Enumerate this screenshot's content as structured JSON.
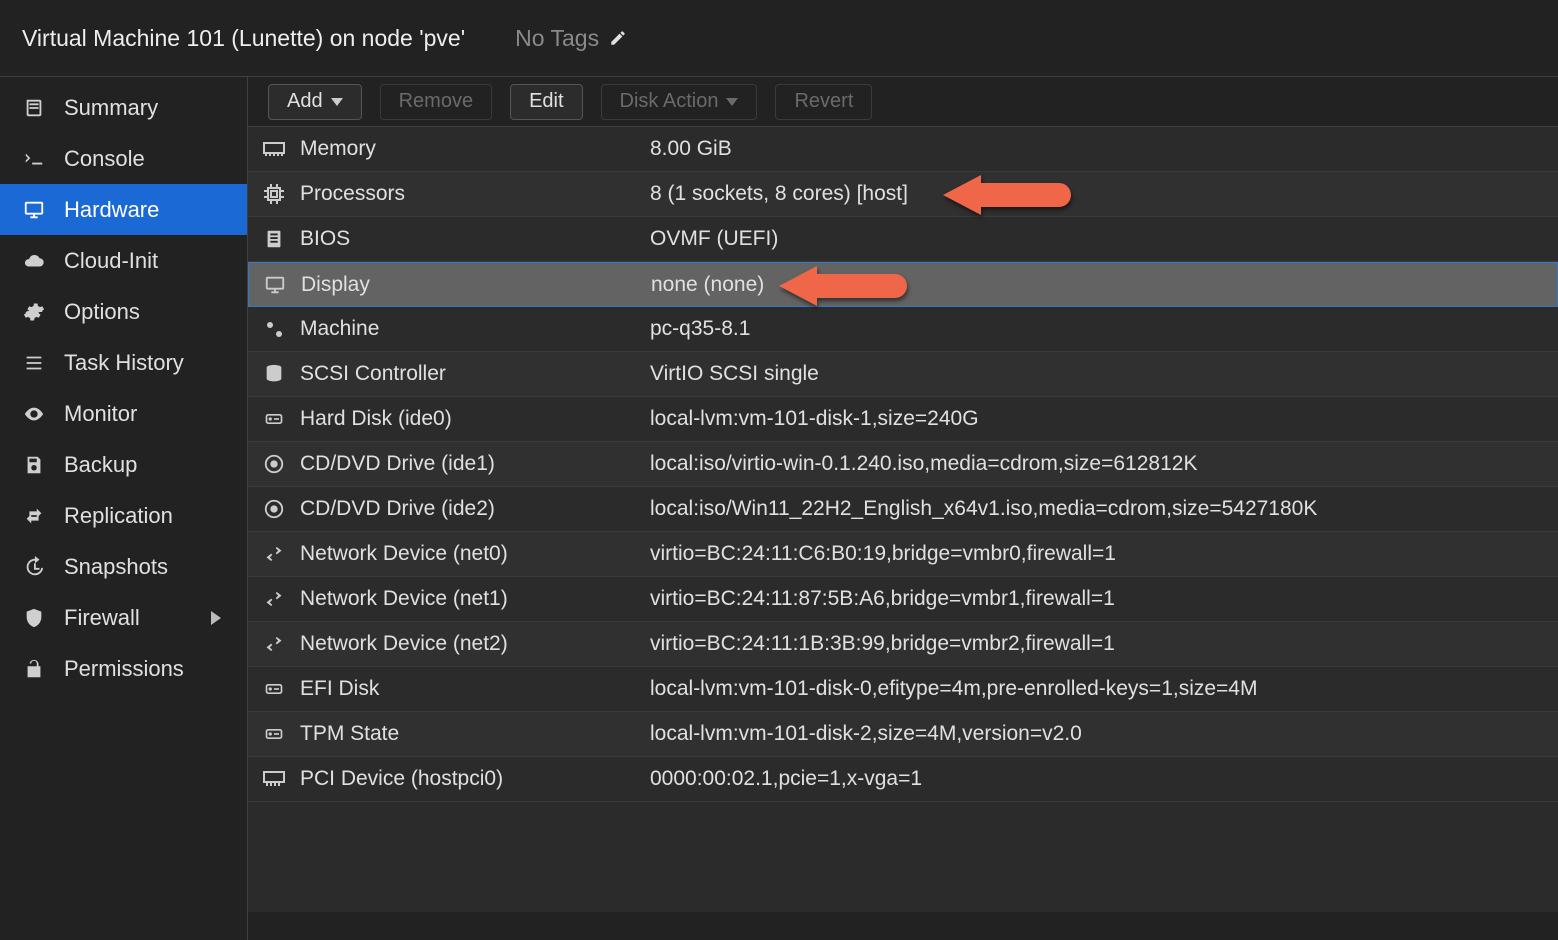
{
  "header": {
    "title": "Virtual Machine 101 (Lunette) on node 'pve'",
    "no_tags": "No Tags"
  },
  "sidebar": {
    "items": [
      {
        "id": "summary",
        "label": "Summary",
        "icon": "book-icon"
      },
      {
        "id": "console",
        "label": "Console",
        "icon": "terminal-icon"
      },
      {
        "id": "hardware",
        "label": "Hardware",
        "icon": "monitor-icon",
        "active": true
      },
      {
        "id": "cloud-init",
        "label": "Cloud-Init",
        "icon": "cloud-icon"
      },
      {
        "id": "options",
        "label": "Options",
        "icon": "gear-icon"
      },
      {
        "id": "task-history",
        "label": "Task History",
        "icon": "list-icon"
      },
      {
        "id": "monitor",
        "label": "Monitor",
        "icon": "eye-icon"
      },
      {
        "id": "backup",
        "label": "Backup",
        "icon": "floppy-icon"
      },
      {
        "id": "replication",
        "label": "Replication",
        "icon": "retweet-icon"
      },
      {
        "id": "snapshots",
        "label": "Snapshots",
        "icon": "history-icon"
      },
      {
        "id": "firewall",
        "label": "Firewall",
        "icon": "shield-icon",
        "has_children": true
      },
      {
        "id": "permissions",
        "label": "Permissions",
        "icon": "unlock-icon"
      }
    ]
  },
  "toolbar": {
    "add": "Add",
    "remove": "Remove",
    "edit": "Edit",
    "disk_action": "Disk Action",
    "revert": "Revert"
  },
  "hardware": [
    {
      "icon": "memory-icon",
      "key": "Memory",
      "value": "8.00 GiB"
    },
    {
      "icon": "cpu-icon",
      "key": "Processors",
      "value": "8 (1 sockets, 8 cores) [host]",
      "arrow": true
    },
    {
      "icon": "chip-icon",
      "key": "BIOS",
      "value": "OVMF (UEFI)"
    },
    {
      "icon": "monitor-icon",
      "key": "Display",
      "value": "none (none)",
      "highlight": true,
      "arrow": true
    },
    {
      "icon": "gears-icon",
      "key": "Machine",
      "value": "pc-q35-8.1"
    },
    {
      "icon": "database-icon",
      "key": "SCSI Controller",
      "value": "VirtIO SCSI single"
    },
    {
      "icon": "hdd-icon",
      "key": "Hard Disk (ide0)",
      "value": "local-lvm:vm-101-disk-1,size=240G"
    },
    {
      "icon": "disc-icon",
      "key": "CD/DVD Drive (ide1)",
      "value": "local:iso/virtio-win-0.1.240.iso,media=cdrom,size=612812K"
    },
    {
      "icon": "disc-icon",
      "key": "CD/DVD Drive (ide2)",
      "value": "local:iso/Win11_22H2_English_x64v1.iso,media=cdrom,size=5427180K"
    },
    {
      "icon": "exchange-icon",
      "key": "Network Device (net0)",
      "value": "virtio=BC:24:11:C6:B0:19,bridge=vmbr0,firewall=1"
    },
    {
      "icon": "exchange-icon",
      "key": "Network Device (net1)",
      "value": "virtio=BC:24:11:87:5B:A6,bridge=vmbr1,firewall=1"
    },
    {
      "icon": "exchange-icon",
      "key": "Network Device (net2)",
      "value": "virtio=BC:24:11:1B:3B:99,bridge=vmbr2,firewall=1"
    },
    {
      "icon": "hdd-icon",
      "key": "EFI Disk",
      "value": "local-lvm:vm-101-disk-0,efitype=4m,pre-enrolled-keys=1,size=4M"
    },
    {
      "icon": "hdd-icon",
      "key": "TPM State",
      "value": "local-lvm:vm-101-disk-2,size=4M,version=v2.0"
    },
    {
      "icon": "pci-icon",
      "key": "PCI Device (hostpci0)",
      "value": "0000:00:02.1,pcie=1,x-vga=1"
    }
  ]
}
